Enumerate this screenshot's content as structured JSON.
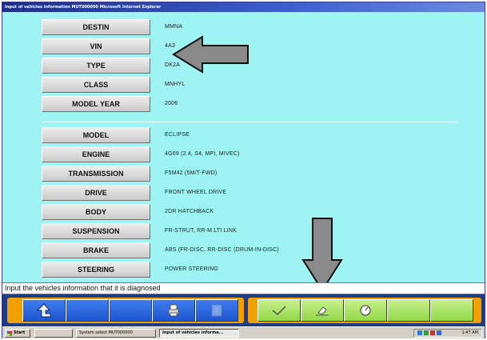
{
  "window": {
    "title": "Input of vehicles information  MUT000000  Microsoft Internet Explorer"
  },
  "vehicle_info": [
    {
      "label": "DESTIN",
      "value": "MMNA"
    },
    {
      "label": "VIN",
      "value": "4A3"
    },
    {
      "label": "TYPE",
      "value": "DK2A"
    },
    {
      "label": "CLASS",
      "value": "MNHYL"
    },
    {
      "label": "MODEL YEAR",
      "value": "2006"
    }
  ],
  "vehicle_spec": [
    {
      "label": "MODEL",
      "value": "ECLIPSE"
    },
    {
      "label": "ENGINE",
      "value": "4G69 (2.4, S4, MPI, MIVEC)"
    },
    {
      "label": "TRANSMISSION",
      "value": "F5M42 (5M/T-FWD)"
    },
    {
      "label": "DRIVE",
      "value": "FRONT WHEEL DRIVE"
    },
    {
      "label": "BODY",
      "value": "2DR HATCHBACK"
    },
    {
      "label": "SUSPENSION",
      "value": "FR-STRUT, RR-M.LTI LINK"
    },
    {
      "label": "BRAKE",
      "value": "ABS (FR-DISC, RR-DISC (DRUM-IN-DISC)"
    },
    {
      "label": "STEERING",
      "value": "POWER STEERING"
    }
  ],
  "status": {
    "message": "Input the vehicles information that it is diagnosed"
  },
  "toolbar": {
    "icons": [
      "up-arrow-icon",
      "blank",
      "blank",
      "print-icon",
      "help-icon",
      "checkmark-icon",
      "eraser-icon",
      "gauge-icon",
      "blank",
      "blank"
    ]
  },
  "taskbar": {
    "start_label": "Start",
    "tasks": [
      "System select  MUT000000",
      "Input of vehicles informa..."
    ],
    "clock": "1:47 AM"
  },
  "colors": {
    "content_bg": "#9ef3f3",
    "toolbar_bg": "#1e3c86",
    "orange": "#f2a000",
    "blue_button": "#2f6ae6",
    "green_button": "#b6e870"
  }
}
